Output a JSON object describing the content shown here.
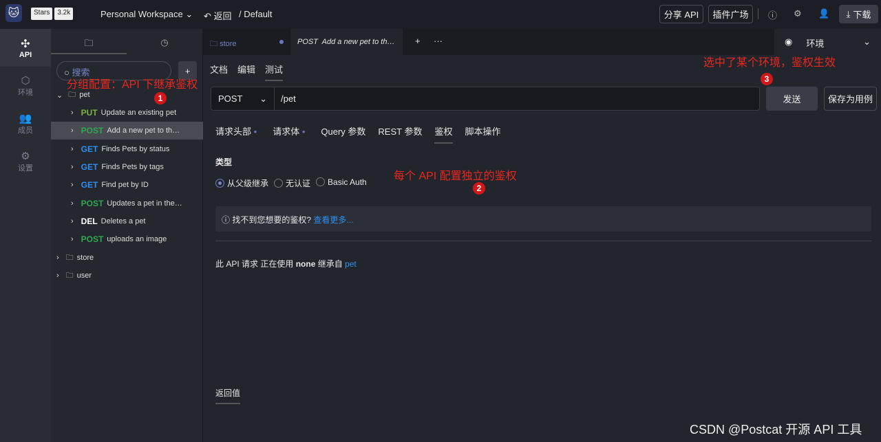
{
  "header": {
    "workspace": "Personal Workspace",
    "stars_label": "Stars",
    "stars_count": "3.2k",
    "back": "返回",
    "breadcrumb": "Default",
    "share": "分享 API",
    "plugins": "插件广场",
    "download": "下载"
  },
  "nav": [
    {
      "label": "API",
      "icon": "api-icon"
    },
    {
      "label": "环境",
      "icon": "environment-icon"
    },
    {
      "label": "成员",
      "icon": "members-icon"
    },
    {
      "label": "设置",
      "icon": "settings-icon"
    }
  ],
  "tree": {
    "search_placeholder": "搜索",
    "root": "pet",
    "items": [
      {
        "method": "PUT",
        "name": "Update an existing pet",
        "color": "#7cb342"
      },
      {
        "method": "POST",
        "name": "Add a new pet to th…",
        "color": "#2fa84f"
      },
      {
        "method": "GET",
        "name": "Finds Pets by status",
        "color": "#2f8fef"
      },
      {
        "method": "GET",
        "name": "Finds Pets by tags",
        "color": "#2f8fef"
      },
      {
        "method": "GET",
        "name": "Find pet by ID",
        "color": "#2f8fef"
      },
      {
        "method": "POST",
        "name": "Updates a pet in the…",
        "color": "#2fa84f"
      },
      {
        "method": "DEL",
        "name": "Deletes a pet",
        "color": "#ffffff"
      },
      {
        "method": "POST",
        "name": "uploads an image",
        "color": "#2fa84f"
      }
    ],
    "folders": [
      "store",
      "user"
    ]
  },
  "tabs": [
    {
      "label": "store"
    },
    {
      "label": "POST  Add a new pet to th…"
    }
  ],
  "env": {
    "label": "环境"
  },
  "subtabs": [
    "文档",
    "编辑",
    "测试"
  ],
  "request": {
    "method": "POST",
    "url": "/pet",
    "send": "发送",
    "save": "保存为用例"
  },
  "reqtabs": [
    "请求头部",
    "请求体",
    "Query 参数",
    "REST 参数",
    "鉴权",
    "脚本操作"
  ],
  "auth": {
    "type_label": "类型",
    "options": [
      "从父级继承",
      "无认证",
      "Basic Auth"
    ],
    "selected": "从父级继承",
    "notice": "找不到您想要的鉴权?",
    "notice_link": "查看更多...",
    "status_prefix": "此 API 请求 正在使用",
    "status_type": "none",
    "status_mid": "继承自",
    "status_parent": "pet"
  },
  "response": {
    "label": "返回值"
  },
  "annotations": [
    {
      "text": "分组配置：API 下继承鉴权",
      "num": "1"
    },
    {
      "text": "每个 API 配置独立的鉴权",
      "num": "2"
    },
    {
      "text": "选中了某个环境，鉴权生效",
      "num": "3"
    }
  ],
  "watermark": "CSDN @Postcat 开源 API 工具"
}
